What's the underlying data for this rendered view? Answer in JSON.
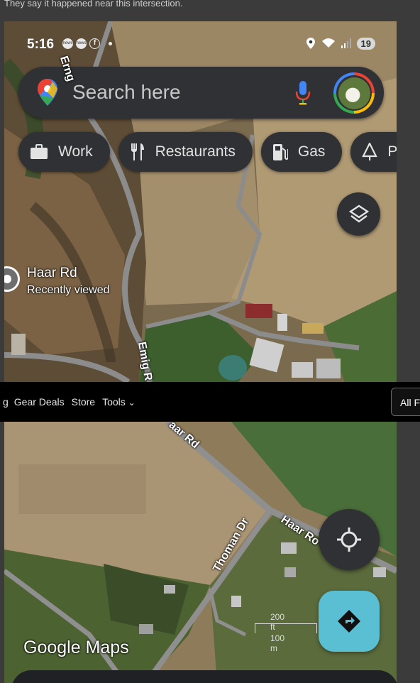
{
  "caption": "They say it happened near this intersection.",
  "top_screenshot": {
    "status": {
      "time": "5:16",
      "left_icons": [
        "news-icon",
        "news-icon",
        "facebook-icon"
      ],
      "battery": "19"
    },
    "search": {
      "placeholder": "Search here"
    },
    "chips": [
      {
        "label": "Work",
        "icon": "briefcase-icon"
      },
      {
        "label": "Restaurants",
        "icon": "fork-knife-icon"
      },
      {
        "label": "Gas",
        "icon": "gas-pump-icon"
      },
      {
        "label": "P",
        "icon": "tree-icon"
      }
    ],
    "place": {
      "name": "Haar Rd",
      "subtitle": "Recently viewed"
    },
    "road_labels": {
      "erng": "Erng",
      "emig": "Emig R"
    }
  },
  "web_strip": {
    "nav": [
      "g",
      "Gear Deals",
      "Store",
      "Tools"
    ],
    "tools_chevron": "⌄",
    "all_button": "All F"
  },
  "bottom_screenshot": {
    "road_labels": {
      "haar_top": "aar Rd",
      "thoman": "Thoman Dr",
      "haar_right": "Haar Ro"
    },
    "scale": {
      "top": "200 ft",
      "bottom": "100 m"
    },
    "logo": "Google Maps"
  },
  "colors": {
    "chrome": "#303134",
    "directions": "#5bbfd3",
    "field": "#a08c6a",
    "grass": "#4d6b37",
    "road": "#9a9a9a"
  }
}
